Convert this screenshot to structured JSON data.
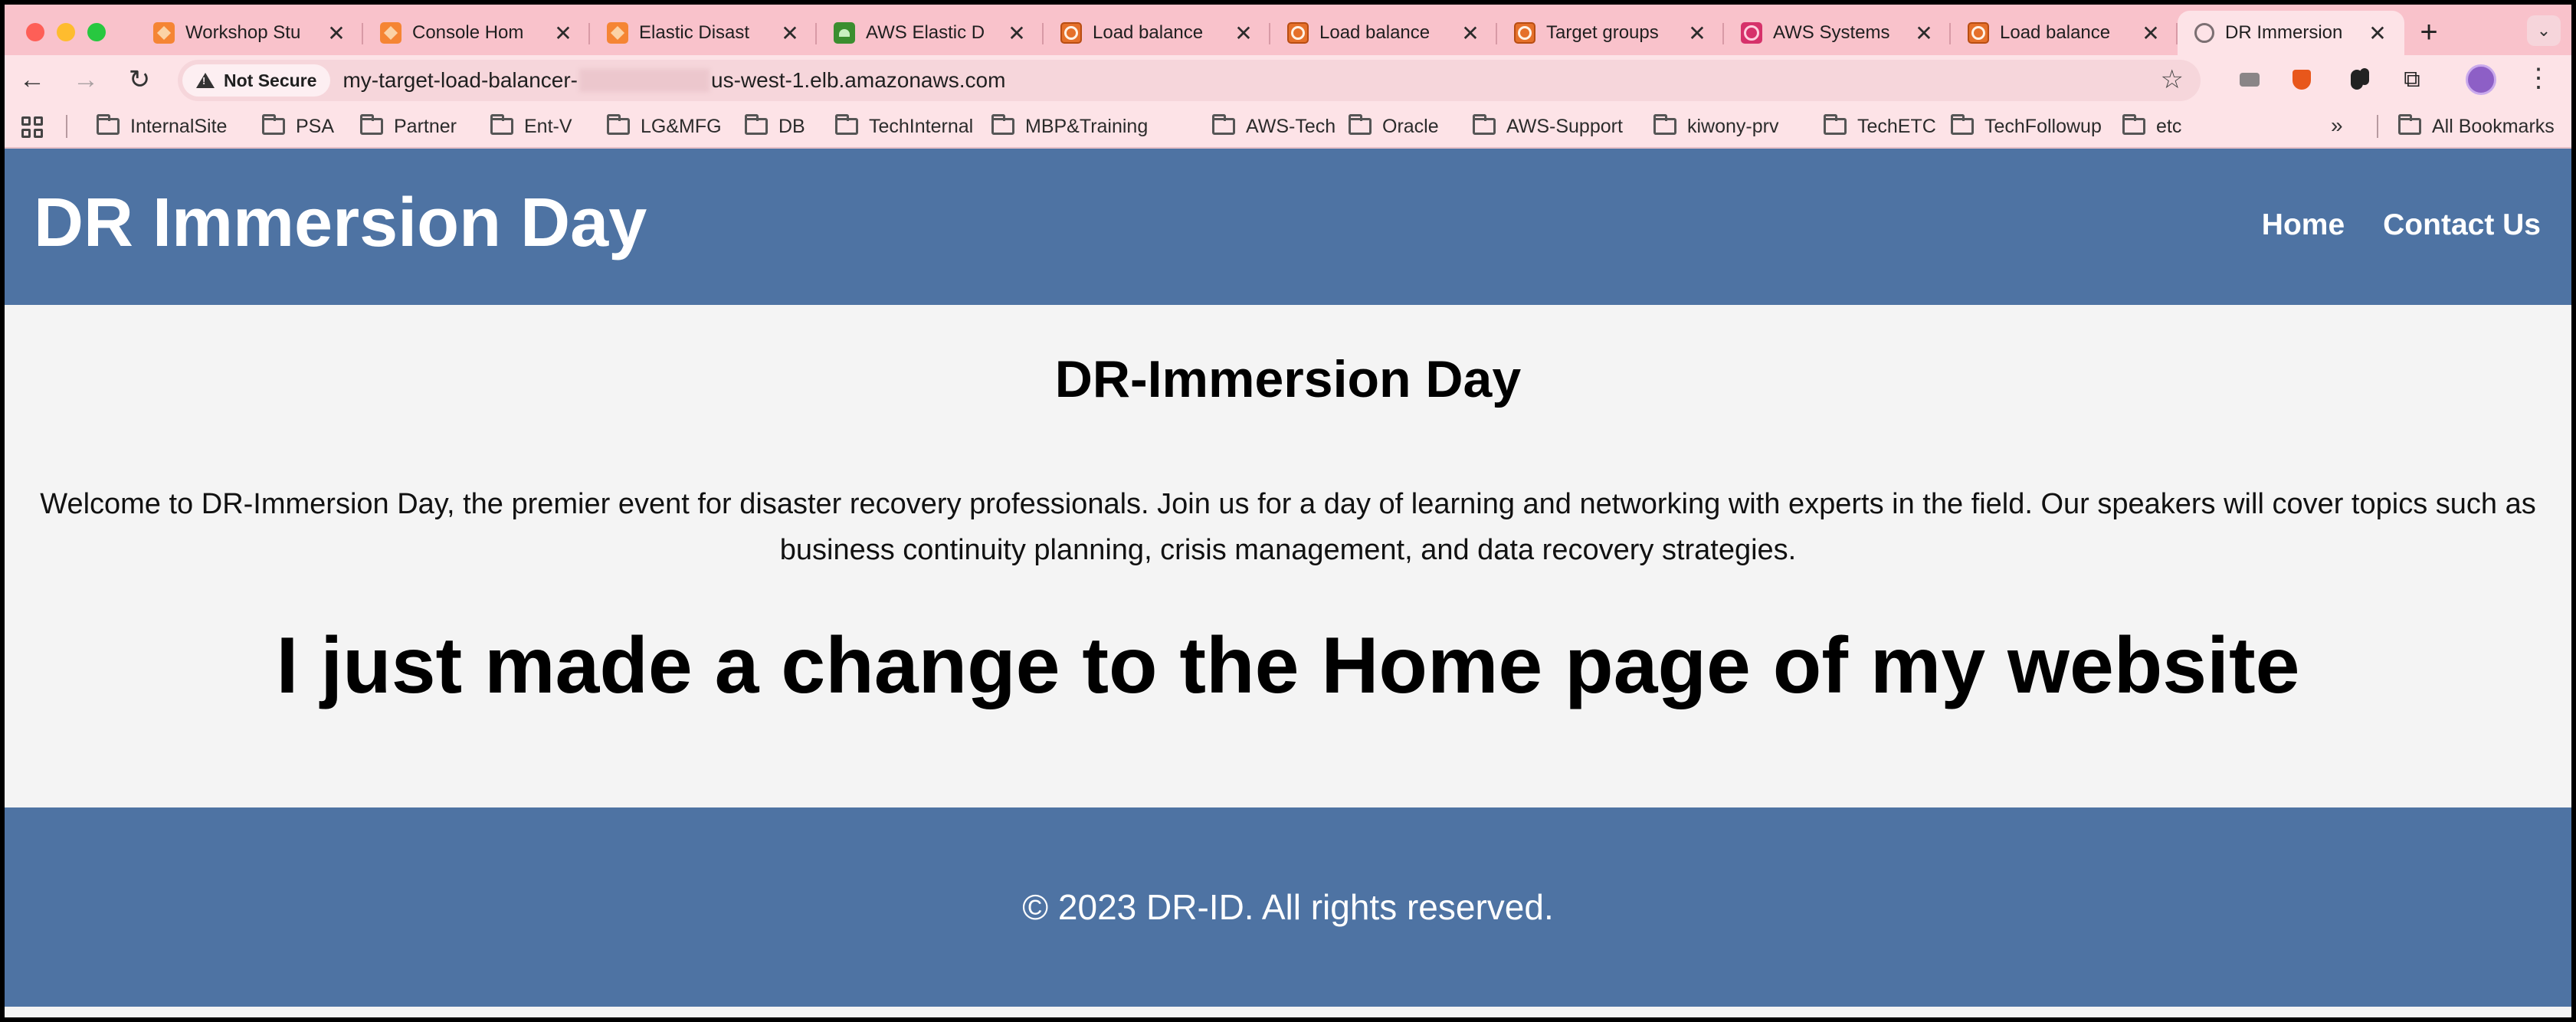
{
  "browser": {
    "tabs": [
      {
        "title": "Workshop Stu",
        "favicon": "aws-cube-icon"
      },
      {
        "title": "Console Hom",
        "favicon": "aws-cube-icon"
      },
      {
        "title": "Elastic Disast",
        "favicon": "aws-cube-icon"
      },
      {
        "title": "AWS Elastic D",
        "favicon": "aws-drs-icon"
      },
      {
        "title": "Load balance",
        "favicon": "load-balancer-icon"
      },
      {
        "title": "Load balance",
        "favicon": "load-balancer-icon"
      },
      {
        "title": "Target groups",
        "favicon": "load-balancer-icon"
      },
      {
        "title": "AWS Systems",
        "favicon": "aws-systems-manager-icon"
      },
      {
        "title": "Load balance",
        "favicon": "load-balancer-icon"
      },
      {
        "title": "DR Immersion",
        "favicon": "globe-icon",
        "active": true
      }
    ],
    "new_tab": "+",
    "close_glyph": "✕",
    "security_label": "Not Secure",
    "url_prefix": "my-target-load-balancer-",
    "url_suffix": "us-west-1.elb.amazonaws.com",
    "bookmarks": [
      "InternalSite",
      "PSA",
      "Partner",
      "Ent-V",
      "LG&MFG",
      "DB",
      "TechInternal",
      "MBP&Training",
      "AWS-Tech",
      "Oracle",
      "AWS-Support",
      "kiwony-prv",
      "TechETC",
      "TechFollowup",
      "etc"
    ],
    "bookmarks_overflow": "»",
    "all_bookmarks": "All Bookmarks",
    "colors": {
      "tab_strip": "#f9c2cb",
      "toolbar": "#fde3e7"
    }
  },
  "site": {
    "title": "DR Immersion Day",
    "nav": {
      "home": "Home",
      "contact": "Contact Us"
    },
    "heading": "DR-Immersion Day",
    "intro": "Welcome to DR-Immersion Day, the premier event for disaster recovery professionals. Join us for a day of learning and networking with experts in the field. Our speakers will cover topics such as business continuity planning, crisis management, and data recovery strategies.",
    "banner": "I just made a change to the Home page of my website",
    "footer": "© 2023 DR-ID. All rights reserved.",
    "colors": {
      "header_bg": "#4e73a3",
      "body_bg": "#f4f4f4"
    }
  }
}
